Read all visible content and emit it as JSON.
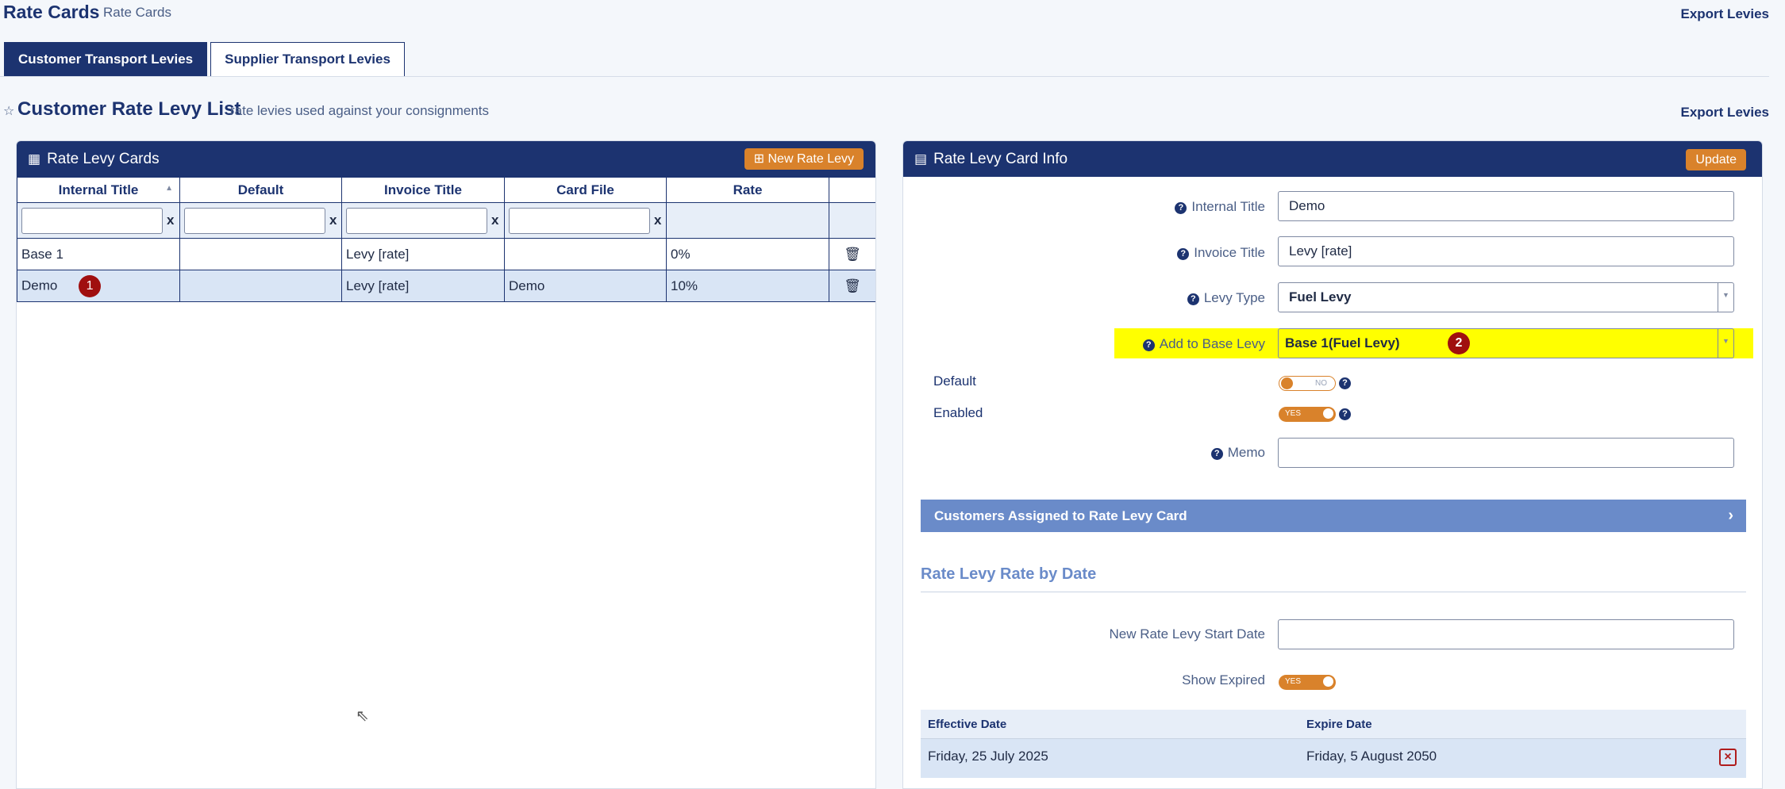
{
  "header": {
    "title": "Rate Cards",
    "subtitle": "Rate Cards",
    "export_label": "Export Levies"
  },
  "tabs": [
    {
      "label": "Customer Transport Levies"
    },
    {
      "label": "Supplier Transport Levies"
    }
  ],
  "list": {
    "title": "Customer Rate Levy List",
    "subtitle": "rate levies used against your consignments",
    "export_label": "Export Levies"
  },
  "left_panel": {
    "title": "Rate Levy Cards",
    "new_button": "New Rate Levy",
    "columns": [
      "Internal Title",
      "Default",
      "Invoice Title",
      "Card File",
      "Rate"
    ],
    "filter_clear": "x",
    "rows": [
      {
        "internal_title": "Base 1",
        "default": "",
        "invoice_title": "Levy [rate]",
        "card_file": "",
        "rate": "0%"
      },
      {
        "internal_title": "Demo",
        "default": "",
        "invoice_title": "Levy [rate]",
        "card_file": "Demo",
        "rate": "10%",
        "badge": "1"
      }
    ]
  },
  "right_panel": {
    "title": "Rate Levy Card Info",
    "update_button": "Update",
    "fields": {
      "internal_title": {
        "label": "Internal Title",
        "value": "Demo"
      },
      "invoice_title": {
        "label": "Invoice Title",
        "value": "Levy [rate]"
      },
      "levy_type": {
        "label": "Levy Type",
        "value": "Fuel Levy"
      },
      "add_to_base": {
        "label": "Add to Base Levy",
        "value": "Base 1(Fuel Levy)",
        "badge": "2"
      },
      "default": {
        "label": "Default",
        "state": "NO"
      },
      "enabled": {
        "label": "Enabled",
        "state": "YES"
      },
      "memo": {
        "label": "Memo",
        "value": ""
      }
    },
    "assigned_bar": "Customers Assigned to Rate Levy Card",
    "rate_section_title": "Rate Levy Rate by Date",
    "new_start_date_label": "New Rate Levy Start Date",
    "show_expired_label": "Show Expired",
    "show_expired_state": "YES",
    "dates_table": {
      "columns": [
        "Effective Date",
        "Expire Date"
      ],
      "rows": [
        {
          "effective": "Friday, 25 July 2025",
          "expire": "Friday, 5 August 2050"
        }
      ]
    }
  },
  "colors": {
    "primary": "#1c3370",
    "accent": "#d9822b",
    "highlight": "#ffff00",
    "badge": "#a00f0f",
    "section": "#6a8bc9"
  }
}
